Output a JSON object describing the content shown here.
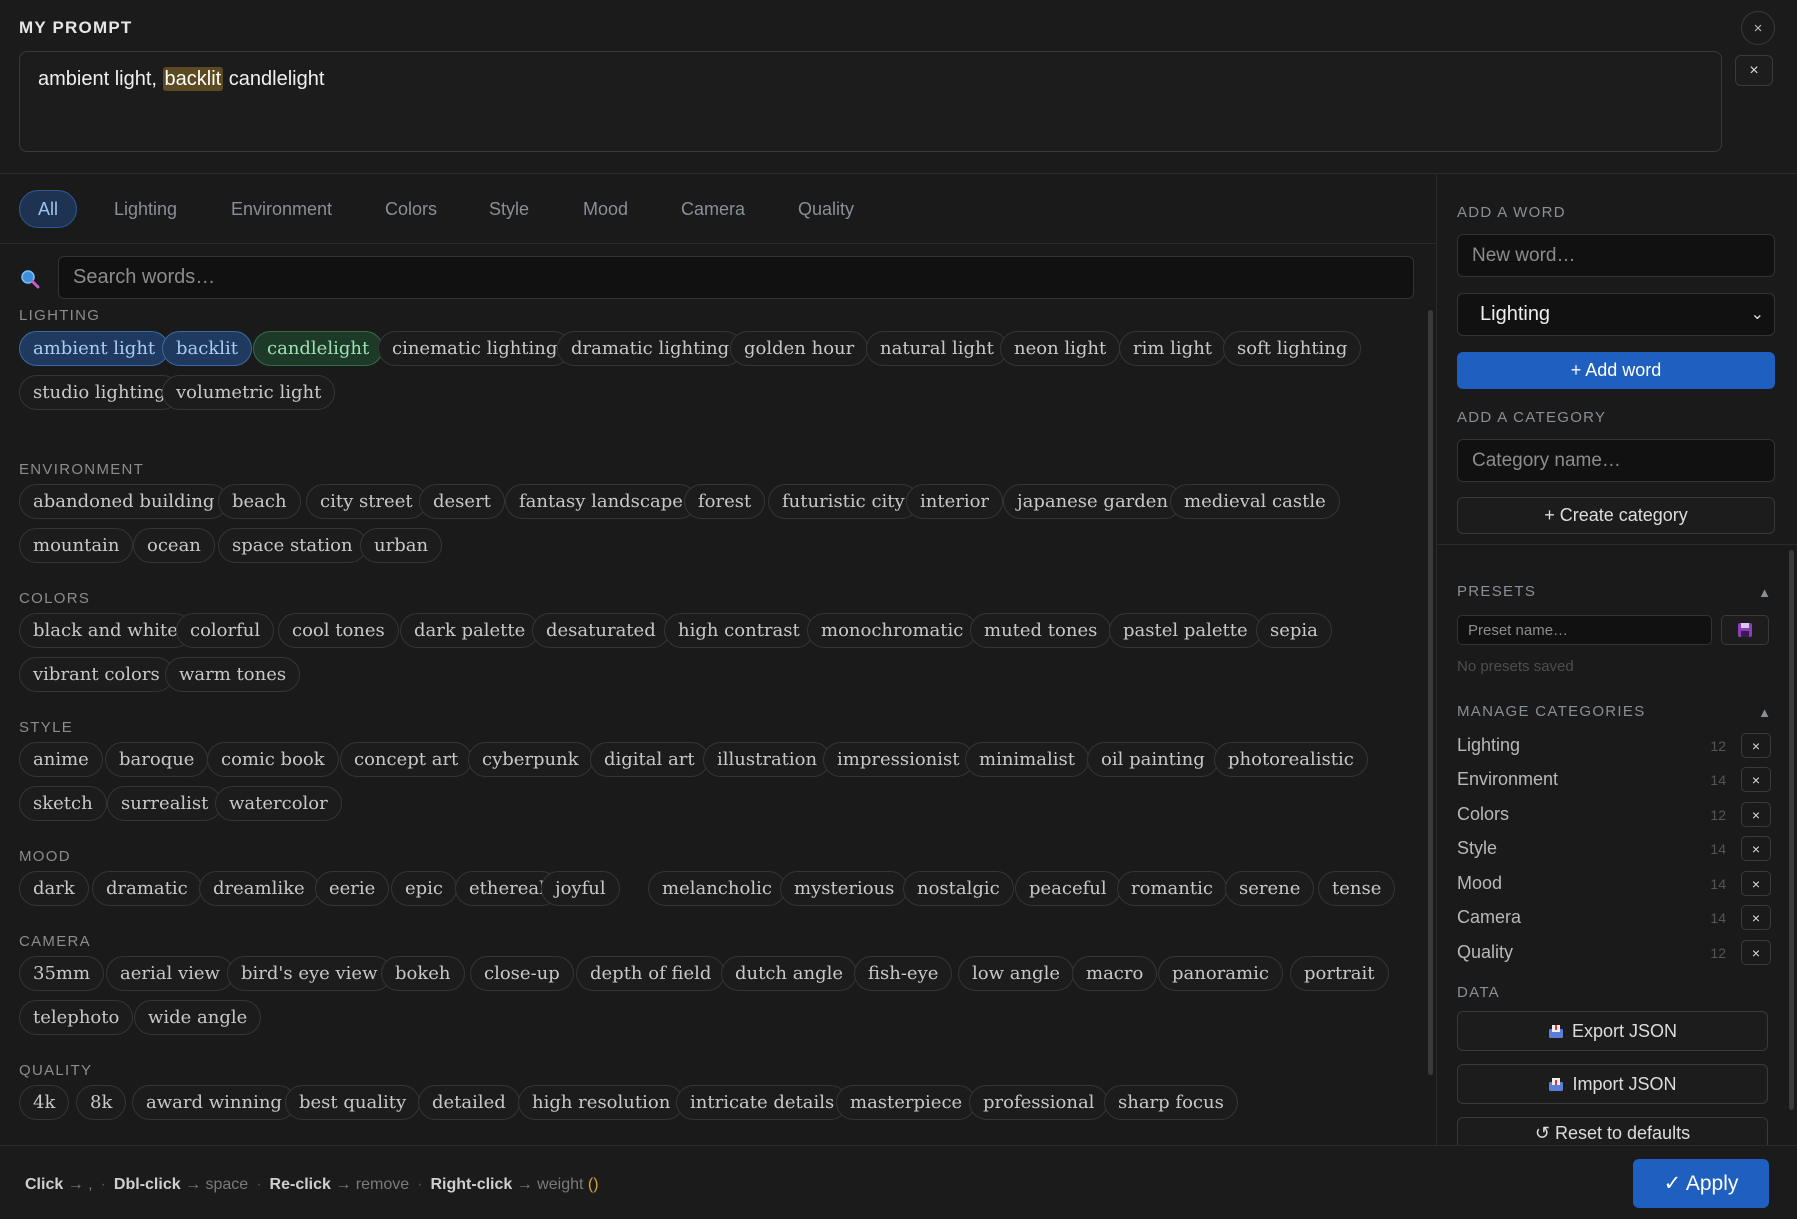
{
  "header": {
    "title": "MY PROMPT",
    "prompt_parts": [
      "ambient light, ",
      "backlit",
      " candlelight"
    ],
    "clear_label": "×",
    "close_label": "×"
  },
  "tabs": [
    "All",
    "Lighting",
    "Environment",
    "Colors",
    "Style",
    "Mood",
    "Camera",
    "Quality"
  ],
  "search": {
    "placeholder": "Search words…"
  },
  "sections": [
    {
      "title": "LIGHTING",
      "words": [
        "ambient light",
        "backlit",
        "candlelight",
        "cinematic lighting",
        "dramatic lighting",
        "golden hour",
        "natural light",
        "neon light",
        "rim light",
        "soft lighting",
        "studio lighting",
        "volumetric light"
      ]
    },
    {
      "title": "ENVIRONMENT",
      "words": [
        "abandoned building",
        "beach",
        "city street",
        "desert",
        "fantasy landscape",
        "forest",
        "futuristic city",
        "interior",
        "japanese garden",
        "medieval castle",
        "mountain",
        "ocean",
        "space station",
        "urban"
      ]
    },
    {
      "title": "COLORS",
      "words": [
        "black and white",
        "colorful",
        "cool tones",
        "dark palette",
        "desaturated",
        "high contrast",
        "monochromatic",
        "muted tones",
        "pastel palette",
        "sepia",
        "vibrant colors",
        "warm tones"
      ]
    },
    {
      "title": "STYLE",
      "words": [
        "anime",
        "baroque",
        "comic book",
        "concept art",
        "cyberpunk",
        "digital art",
        "illustration",
        "impressionist",
        "minimalist",
        "oil painting",
        "photorealistic",
        "sketch",
        "surrealist",
        "watercolor"
      ]
    },
    {
      "title": "MOOD",
      "words": [
        "dark",
        "dramatic",
        "dreamlike",
        "eerie",
        "epic",
        "ethereal",
        "joyful",
        "melancholic",
        "mysterious",
        "nostalgic",
        "peaceful",
        "romantic",
        "serene",
        "tense"
      ]
    },
    {
      "title": "CAMERA",
      "words": [
        "35mm",
        "aerial view",
        "bird's eye view",
        "bokeh",
        "close-up",
        "depth of field",
        "dutch angle",
        "fish-eye",
        "low angle",
        "macro",
        "panoramic",
        "portrait",
        "telephoto",
        "wide angle"
      ]
    },
    {
      "title": "QUALITY",
      "words": [
        "4k",
        "8k",
        "award winning",
        "best quality",
        "detailed",
        "high resolution",
        "intricate details",
        "masterpiece",
        "professional",
        "sharp focus"
      ]
    }
  ],
  "selected": {
    "blue": [
      "ambient light",
      "backlit"
    ],
    "green": [
      "candlelight"
    ]
  },
  "sidebar": {
    "add_word_label": "ADD A WORD",
    "new_word_placeholder": "New word…",
    "category_select": "Lighting",
    "add_word_button": "+ Add word",
    "add_category_label": "ADD A CATEGORY",
    "category_name_placeholder": "Category name…",
    "create_category_button": "+ Create category",
    "presets_label": "PRESETS",
    "preset_name_placeholder": "Preset name…",
    "no_presets": "No presets saved",
    "manage_label": "MANAGE CATEGORIES",
    "collapse_icon": "▲",
    "categories": [
      {
        "name": "Lighting",
        "count": "12"
      },
      {
        "name": "Environment",
        "count": "14"
      },
      {
        "name": "Colors",
        "count": "12"
      },
      {
        "name": "Style",
        "count": "14"
      },
      {
        "name": "Mood",
        "count": "14"
      },
      {
        "name": "Camera",
        "count": "14"
      },
      {
        "name": "Quality",
        "count": "12"
      }
    ],
    "data_label": "DATA",
    "export_button": "Export JSON",
    "import_button": "Import JSON",
    "reset_button": "↺ Reset to defaults"
  },
  "footer": {
    "hints": [
      {
        "key": "Click",
        "action": "→ ,"
      },
      {
        "key": "Dbl-click",
        "action": "→ space"
      },
      {
        "key": "Re-click",
        "action": "→ remove"
      },
      {
        "key": "Right-click",
        "action": "→ weight",
        "extra": "()"
      }
    ],
    "apply_button": "✓ Apply"
  },
  "colors": {
    "accent": "#1f5fbf",
    "selected_blue": "#1f3a5e",
    "selected_green": "#1d3a28",
    "highlight": "#5c4b22"
  }
}
